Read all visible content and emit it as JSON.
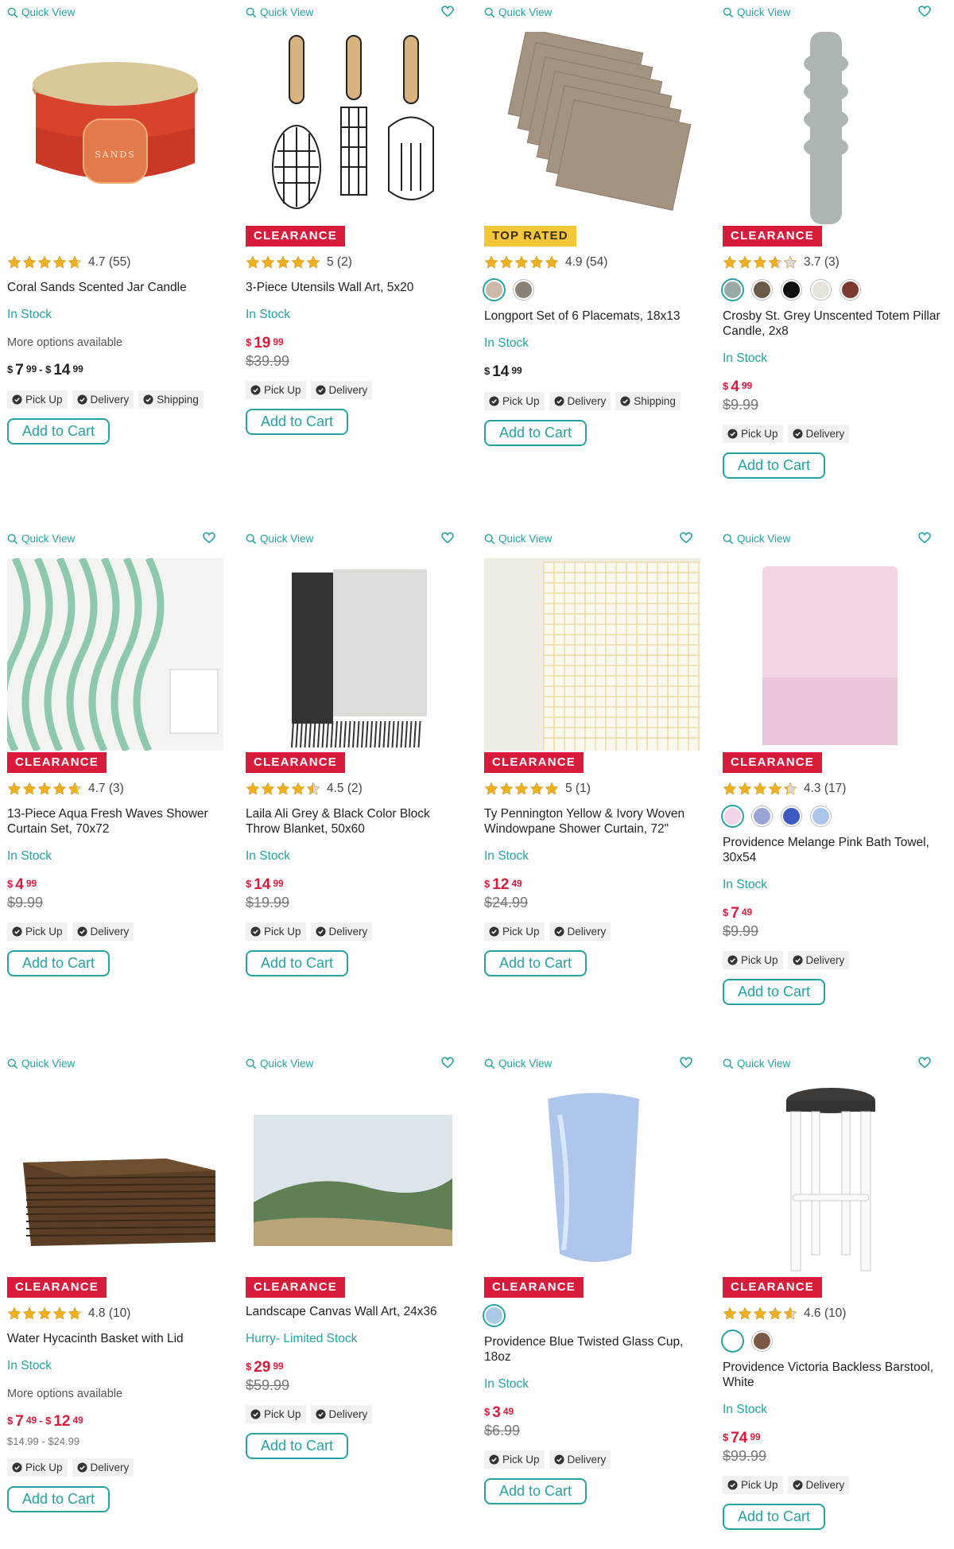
{
  "colors": {
    "accent": "#26a2a2",
    "clearance": "#d81b3a",
    "top_rated": "#f4c73a",
    "star": "#f2b01e"
  },
  "common": {
    "quick_view": "Quick View",
    "add_to_cart": "Add to Cart",
    "pick_up": "Pick Up",
    "delivery": "Delivery",
    "shipping": "Shipping"
  },
  "products": [
    {
      "badge": "",
      "rating": 4.7,
      "rating_text": "4.7 (55)",
      "title": "Coral Sands Scented Jar Candle",
      "stock": "In Stock",
      "more": "More options available",
      "price_from": "7",
      "price_from_c": "99",
      "price_to": "14",
      "price_to_c": "99",
      "range": true,
      "was": "",
      "fulfillment": [
        "Pick Up",
        "Delivery",
        "Shipping"
      ],
      "heart": false,
      "icon": "candle-image"
    },
    {
      "badge": "CLEARANCE",
      "rating": 5,
      "rating_text": "5 (2)",
      "title": "3-Piece Utensils Wall Art, 5x20",
      "stock": "In Stock",
      "price": "19",
      "cents": "99",
      "was": "$39.99",
      "fulfillment": [
        "Pick Up",
        "Delivery"
      ],
      "heart": true,
      "icon": "utensils-art-image"
    },
    {
      "badge": "TOP RATED",
      "rating": 4.9,
      "rating_text": "4.9 (54)",
      "swatches": [
        "#cdb9a8",
        "#8a8177"
      ],
      "title": "Longport Set of 6 Placemats, 18x13",
      "stock": "In Stock",
      "price": "14",
      "cents": "99",
      "was": "",
      "fulfillment": [
        "Pick Up",
        "Delivery",
        "Shipping"
      ],
      "heart": false,
      "icon": "placemats-image"
    },
    {
      "badge": "CLEARANCE",
      "rating": 3.7,
      "rating_text": "3.7 (3)",
      "swatches": [
        "#9aa8a6",
        "#6b5a46",
        "#111111",
        "#e6e4da",
        "#7a3a30"
      ],
      "title": "Crosby St. Grey Unscented Totem Pillar Candle, 2x8",
      "stock": "In Stock",
      "price": "4",
      "cents": "99",
      "was": "$9.99",
      "fulfillment": [
        "Pick Up",
        "Delivery"
      ],
      "heart": true,
      "icon": "totem-candle-image"
    },
    {
      "badge": "CLEARANCE",
      "rating": 4.7,
      "rating_text": "4.7 (3)",
      "title": "13-Piece Aqua Fresh Waves Shower Curtain Set, 70x72",
      "stock": "In Stock",
      "price": "4",
      "cents": "99",
      "was": "$9.99",
      "fulfillment": [
        "Pick Up",
        "Delivery"
      ],
      "heart": true,
      "icon": "wave-curtain-image"
    },
    {
      "badge": "CLEARANCE",
      "rating": 4.5,
      "rating_text": "4.5 (2)",
      "title": "Laila Ali Grey & Black Color Block Throw Blanket, 50x60",
      "stock": "In Stock",
      "price": "14",
      "cents": "99",
      "was": "$19.99",
      "fulfillment": [
        "Pick Up",
        "Delivery"
      ],
      "heart": true,
      "icon": "blanket-image"
    },
    {
      "badge": "CLEARANCE",
      "rating": 5,
      "rating_text": "5 (1)",
      "title": "Ty Pennington Yellow & Ivory Woven Windowpane Shower Curtain, 72\"",
      "stock": "In Stock",
      "price": "12",
      "cents": "49",
      "was": "$24.99",
      "fulfillment": [
        "Pick Up",
        "Delivery"
      ],
      "heart": true,
      "icon": "windowpane-curtain-image"
    },
    {
      "badge": "CLEARANCE",
      "rating": 4.3,
      "rating_text": "4.3 (17)",
      "swatches": [
        "#f3d3e6",
        "#9aa5d6",
        "#3c5bc0",
        "#a8c4ea"
      ],
      "title": "Providence Melange Pink Bath Towel, 30x54",
      "stock": "In Stock",
      "price": "7",
      "cents": "49",
      "was": "$9.99",
      "fulfillment": [
        "Pick Up",
        "Delivery"
      ],
      "heart": true,
      "icon": "towel-image"
    },
    {
      "badge": "CLEARANCE",
      "rating": 4.8,
      "rating_text": "4.8 (10)",
      "title": "Water Hycacinth Basket with Lid",
      "stock": "In Stock",
      "more": "More options available",
      "price_from": "7",
      "price_from_c": "49",
      "price_to": "12",
      "price_to_c": "49",
      "range": true,
      "range_sub": "$14.99 - $24.99",
      "fulfillment": [
        "Pick Up",
        "Delivery"
      ],
      "heart": false,
      "icon": "basket-image"
    },
    {
      "badge": "CLEARANCE",
      "title": "Landscape Canvas Wall Art, 24x36",
      "stock": "Hurry- Limited Stock",
      "price": "29",
      "cents": "99",
      "was": "$59.99",
      "fulfillment": [
        "Pick Up",
        "Delivery"
      ],
      "heart": true,
      "icon": "canvas-art-image"
    },
    {
      "badge": "CLEARANCE",
      "swatches": [
        "#a9c9e6"
      ],
      "title": "Providence Blue Twisted Glass Cup, 18oz",
      "stock": "In Stock",
      "price": "3",
      "cents": "49",
      "was": "$6.99",
      "fulfillment": [
        "Pick Up",
        "Delivery"
      ],
      "heart": true,
      "icon": "glass-cup-image"
    },
    {
      "badge": "CLEARANCE",
      "rating": 4.6,
      "rating_text": "4.6 (10)",
      "swatches": [
        "#ffffff",
        "#7a5a44"
      ],
      "title": "Providence Victoria Backless Barstool, White",
      "stock": "In Stock",
      "price": "74",
      "cents": "99",
      "was": "$99.99",
      "fulfillment": [
        "Pick Up",
        "Delivery"
      ],
      "heart": true,
      "icon": "barstool-image"
    }
  ]
}
